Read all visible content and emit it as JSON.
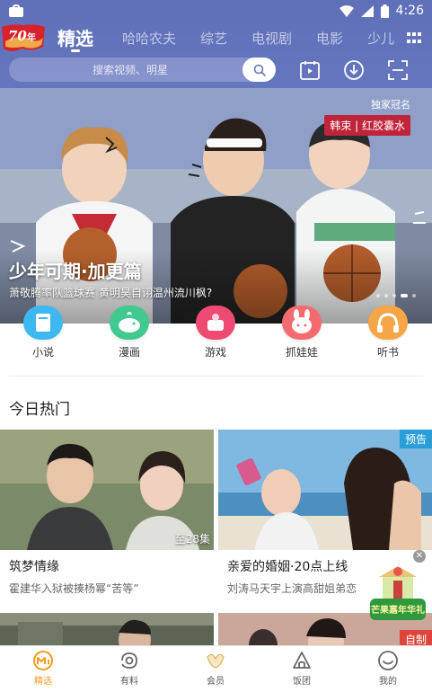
{
  "status_bar": {
    "time": "4:26"
  },
  "logo_text": "70年",
  "tabs": [
    {
      "label": "精选",
      "active": true
    },
    {
      "label": "哈哈农夫"
    },
    {
      "label": "综艺"
    },
    {
      "label": "电视剧"
    },
    {
      "label": "电影"
    },
    {
      "label": "少儿"
    }
  ],
  "search": {
    "placeholder": "搜索视频、明星"
  },
  "header_icons": [
    "calendar-play-icon",
    "download-icon",
    "scan-icon"
  ],
  "banner": {
    "tag_top": "独家冠名",
    "tag_bottom": "韩束 | 红胶囊水",
    "title": "少年可期·加更篇",
    "subtitle": "萧敬腾率队篮球赛 黄明昊自诩温州流川枫?"
  },
  "shortcuts": [
    {
      "label": "小说",
      "icon": "book-icon",
      "color": "#34b8f2"
    },
    {
      "label": "漫画",
      "icon": "whale-icon",
      "color": "#3ecb93"
    },
    {
      "label": "游戏",
      "icon": "cake-icon",
      "color": "#f04a73"
    },
    {
      "label": "抓娃娃",
      "icon": "bunny-icon",
      "color": "#f36c70"
    },
    {
      "label": "听书",
      "icon": "headphones-icon",
      "color": "#f6a346"
    }
  ],
  "section": {
    "title": "今日热门"
  },
  "cards": [
    {
      "title": "筑梦情缘",
      "subtitle": "霍建华入狱被揍杨幂“苦等”",
      "episodes": "至28集"
    },
    {
      "title": "亲爱的婚姻·20点上线",
      "subtitle": "刘涛马天宇上演高甜姐弟恋",
      "badge": "预告"
    }
  ],
  "row2_badge": "自制",
  "promo": {
    "text": "芒果嘉年华礼",
    "close": "✕"
  },
  "bottom_nav": [
    {
      "label": "精选",
      "icon": "home-m-icon",
      "active": true
    },
    {
      "label": "有料",
      "icon": "discover-icon"
    },
    {
      "label": "会员",
      "icon": "member-icon"
    },
    {
      "label": "饭团",
      "icon": "fan-group-icon"
    },
    {
      "label": "我的",
      "icon": "profile-icon"
    }
  ],
  "colors": {
    "header": "#6576bf",
    "accent": "#f39a1e",
    "banner_tag": "#c0243a",
    "badge": "#2a9ed8"
  }
}
